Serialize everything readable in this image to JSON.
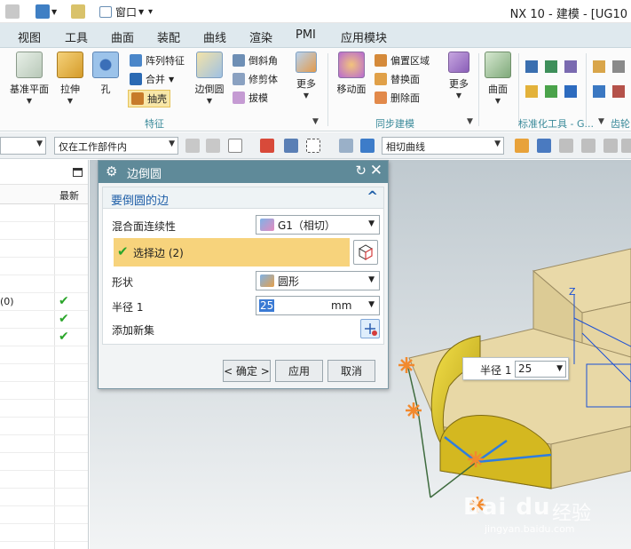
{
  "app": {
    "title": "NX 10 - 建模 - [UG10",
    "window_menu": "窗口"
  },
  "colors": {
    "accent": "#5f8a99",
    "highlight": "#f7d37c",
    "check": "#2aa52a",
    "link": "#1f5fa8",
    "viewport_top": "#bfc9cf",
    "viewport_bottom": "#f2f4f5",
    "solid": "#e8d8a6",
    "fillet": "#d9c12c"
  },
  "tabs": [
    "视图",
    "工具",
    "曲面",
    "装配",
    "曲线",
    "渲染",
    "PMI",
    "应用模块"
  ],
  "ribbon": {
    "feature_group": {
      "label": "特征",
      "big": [
        "基准平面",
        "拉伸",
        "孔",
        "边倒圆",
        "更多"
      ],
      "small": [
        "阵列特征",
        "合并",
        "抽壳",
        "倒斜角",
        "修剪体",
        "拔模"
      ]
    },
    "sync_group": {
      "label": "同步建模",
      "big": [
        "移动面",
        "更多"
      ],
      "small": [
        "偏置区域",
        "替换面",
        "删除面"
      ]
    },
    "surface_big": "曲面",
    "std_group": {
      "label": "标准化工具 - G..."
    },
    "gear_group": {
      "label": "齿轮"
    }
  },
  "selbar": {
    "filter": "仅在工作部件内",
    "curve_rule": "相切曲线"
  },
  "navigator": {
    "col_latest": "最新",
    "rows": [
      {
        "label": "",
        "check": ""
      },
      {
        "label": "",
        "check": ""
      },
      {
        "label": "",
        "check": ""
      },
      {
        "label": "",
        "check": ""
      },
      {
        "label": "",
        "check": ""
      },
      {
        "label": "(0)",
        "check": "✔"
      },
      {
        "label": "",
        "check": "✔"
      },
      {
        "label": "",
        "check": "✔"
      },
      {
        "label": "",
        "check": ""
      },
      {
        "label": "",
        "check": ""
      },
      {
        "label": "",
        "check": ""
      },
      {
        "label": "",
        "check": ""
      },
      {
        "label": "",
        "check": ""
      },
      {
        "label": "",
        "check": ""
      },
      {
        "label": "",
        "check": ""
      },
      {
        "label": "",
        "check": ""
      },
      {
        "label": "",
        "check": ""
      },
      {
        "label": "",
        "check": ""
      },
      {
        "label": "",
        "check": ""
      },
      {
        "label": "",
        "check": ""
      }
    ]
  },
  "dialog": {
    "title": "边倒圆",
    "section": "要倒圆的边",
    "blend_label": "混合面连续性",
    "blend_value": "G1（相切）",
    "select_edge": "选择边 (2)",
    "shape_label": "形状",
    "shape_value": "圆形",
    "radius_label": "半径 1",
    "radius_value": "25",
    "radius_unit": "mm",
    "add_set_label": "添加新集",
    "ok": "< 确定 >",
    "apply": "应用",
    "cancel": "取消"
  },
  "onscreen": {
    "label": "半径 1",
    "value": "25"
  },
  "axis_z": "Z",
  "watermark": {
    "logo": "Bai du",
    "cn": "经验",
    "url": "jingyan.baidu.com"
  }
}
